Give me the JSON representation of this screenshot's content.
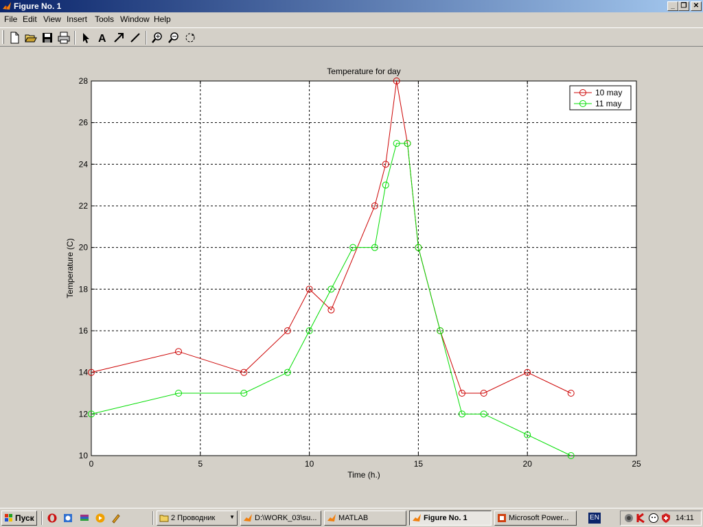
{
  "window": {
    "title": "Figure No. 1",
    "controls": [
      "minimize-icon",
      "restore-icon",
      "close-icon"
    ]
  },
  "menubar": {
    "items": [
      "File",
      "Edit",
      "View",
      "Insert",
      "Tools",
      "Window",
      "Help"
    ]
  },
  "toolbar": {
    "buttons": [
      "new-file-icon",
      "open-folder-icon",
      "save-icon",
      "print-icon",
      "select-arrow-icon",
      "insert-text-icon",
      "insert-arrow-icon",
      "insert-line-icon",
      "zoom-in-icon",
      "zoom-out-icon",
      "rotate-3d-icon"
    ]
  },
  "chart_data": {
    "type": "line",
    "title": "Temperature for day",
    "xlabel": "Time (h.)",
    "ylabel": "Temperature (C)",
    "xlim": [
      0,
      25
    ],
    "ylim": [
      10,
      28
    ],
    "xticks": [
      0,
      5,
      10,
      15,
      20,
      25
    ],
    "yticks": [
      10,
      12,
      14,
      16,
      18,
      20,
      22,
      24,
      26,
      28
    ],
    "grid": true,
    "legend_position": "top-right",
    "marker": "circle",
    "series": [
      {
        "name": "10 may",
        "color": "#cc0000",
        "x": [
          0,
          4,
          7,
          9,
          10,
          11,
          13,
          13.5,
          14,
          14.5,
          15,
          16,
          17,
          18,
          20,
          22
        ],
        "y": [
          14,
          15,
          14,
          16,
          18,
          17,
          22,
          24,
          28,
          25,
          20,
          16,
          13,
          13,
          14,
          13
        ]
      },
      {
        "name": "11 may",
        "color": "#00dd00",
        "x": [
          0,
          4,
          7,
          9,
          10,
          11,
          12,
          13,
          13.5,
          14,
          14.5,
          15,
          16,
          17,
          18,
          20,
          22
        ],
        "y": [
          12,
          13,
          13,
          14,
          16,
          18,
          20,
          20,
          23,
          25,
          25,
          20,
          16,
          12,
          12,
          11,
          10
        ]
      }
    ]
  },
  "taskbar": {
    "start_label": "Пуск",
    "quick_launch": [
      "opera-icon",
      "outlook-icon",
      "winrar-icon",
      "media-player-icon",
      "tool-icon"
    ],
    "tasks": [
      {
        "label": "2 Проводник",
        "icon": "folder-icon",
        "active": false
      },
      {
        "label": "D:\\WORK_03\\su...",
        "icon": "matlab-icon",
        "active": false
      },
      {
        "label": "MATLAB",
        "icon": "matlab-icon",
        "active": false
      },
      {
        "label": "Figure No. 1",
        "icon": "matlab-icon",
        "active": true
      },
      {
        "label": "Microsoft Power...",
        "icon": "powerpoint-icon",
        "active": false
      }
    ],
    "language": "EN",
    "tray_icons": [
      "speaker-icon",
      "antivirus-icon",
      "agent-icon",
      "shield-icon"
    ],
    "clock": "14:11"
  }
}
